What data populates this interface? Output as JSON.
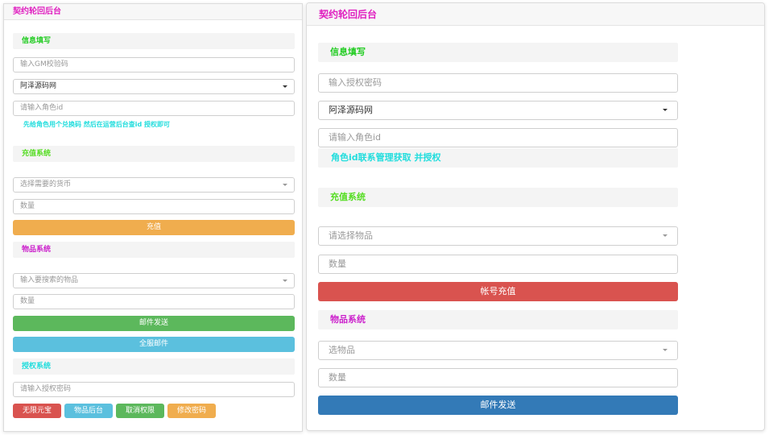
{
  "colors": {
    "title": "#e020c0",
    "section_green": "#22cc22",
    "section_lime": "#55dd22",
    "section_magenta": "#cc22cc",
    "section_cyan": "#22dddd",
    "hint_cyan": "#22dddd",
    "btn_orange": "#f0ad4e",
    "btn_green": "#5cb85c",
    "btn_cyan": "#5bc0de",
    "btn_red": "#d9534f",
    "btn_blue": "#337ab7"
  },
  "left": {
    "title": "契约轮回后台",
    "info": {
      "section": "信息填写",
      "gm_placeholder": "输入GM校验码",
      "server_select": "阿泽源码网",
      "role_placeholder": "请输入角色id",
      "hint": "先给角色用个兑换码 然后在运营后台查id 授权即可"
    },
    "recharge": {
      "section": "充值系统",
      "currency_placeholder": "选择需要的货币",
      "quantity_placeholder": "数量",
      "button": "充值"
    },
    "items": {
      "section": "物品系统",
      "item_placeholder": "输入要搜索的物品",
      "quantity_placeholder": "数量",
      "mail_button": "邮件发送",
      "all_mail_button": "全服邮件"
    },
    "auth": {
      "section": "授权系统",
      "password_placeholder": "请输入授权密码",
      "buttons": [
        "无限元宝",
        "物品后台",
        "取消权限",
        "修改密码"
      ]
    }
  },
  "right": {
    "title": "契约轮回后台",
    "info": {
      "section": "信息填写",
      "auth_placeholder": "输入授权密码",
      "server_select": "阿泽源码网",
      "role_placeholder": "请输入角色id",
      "hint": "角色id联系管理获取 并授权"
    },
    "recharge": {
      "section": "充值系统",
      "item_placeholder": "请选择物品",
      "quantity_placeholder": "数量",
      "button": "帐号充值"
    },
    "items": {
      "section": "物品系统",
      "item_placeholder": "选物品",
      "quantity_placeholder": "数量",
      "mail_button": "邮件发送"
    }
  }
}
